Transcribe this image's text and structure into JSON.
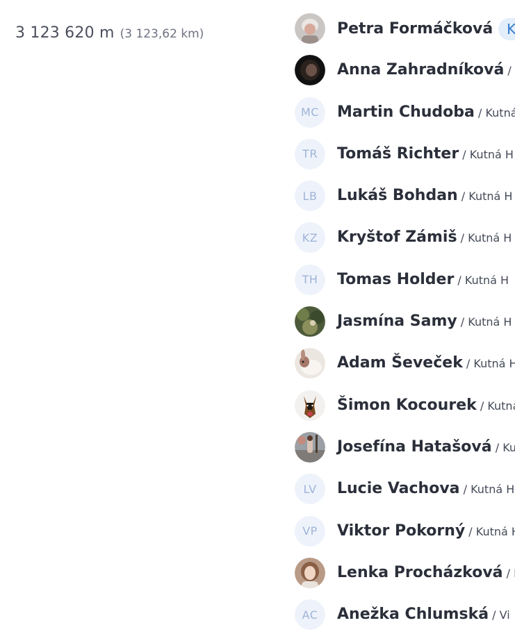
{
  "distance": {
    "meters": "3 123 620 m",
    "kilometers": "(3 123,62 km)"
  },
  "users": [
    {
      "name": "Petra Formáčková",
      "city": "",
      "badge": "Ka",
      "avatar_type": "photo",
      "avatar_icon": "avatar-photo-gray-icon"
    },
    {
      "name": "Anna Zahradníková",
      "city": " / K",
      "avatar_type": "photo",
      "avatar_icon": "avatar-photo-dark-icon"
    },
    {
      "name": "Martin Chudoba",
      "city": " / Kutná",
      "avatar_type": "initials",
      "initials": "MC"
    },
    {
      "name": "Tomáš Richter",
      "city": " / Kutná H",
      "avatar_type": "initials",
      "initials": "TR"
    },
    {
      "name": "Lukáš Bohdan",
      "city": " / Kutná H",
      "avatar_type": "initials",
      "initials": "LB"
    },
    {
      "name": "Kryštof Zámiš",
      "city": " / Kutná H",
      "avatar_type": "initials",
      "initials": "KZ"
    },
    {
      "name": "Tomas Holder",
      "city": " / Kutná H",
      "avatar_type": "initials",
      "initials": "TH"
    },
    {
      "name": "Jasmína Samy",
      "city": " / Kutná H",
      "avatar_type": "photo",
      "avatar_icon": "avatar-photo-plant-icon"
    },
    {
      "name": "Adam Ševeček",
      "city": " / Kutná H",
      "avatar_type": "photo",
      "avatar_icon": "avatar-photo-rabbit-icon"
    },
    {
      "name": "Šimon Kocourek",
      "city": " / Kutná",
      "avatar_type": "photo",
      "avatar_icon": "avatar-photo-dog-icon"
    },
    {
      "name": "Josefína Hatašová",
      "city": " / Ku",
      "avatar_type": "photo",
      "avatar_icon": "avatar-photo-street-icon"
    },
    {
      "name": "Lucie Vachova",
      "city": " / Kutná H",
      "avatar_type": "initials",
      "initials": "LV"
    },
    {
      "name": "Viktor Pokorný",
      "city": " / Kutná H",
      "avatar_type": "initials",
      "initials": "VP"
    },
    {
      "name": "Lenka Procházková",
      "city": " / K",
      "avatar_type": "photo",
      "avatar_icon": "avatar-photo-portrait-icon"
    },
    {
      "name": "Anežka Chlumská",
      "city": " / Vi",
      "avatar_type": "initials",
      "initials": "AC"
    }
  ]
}
